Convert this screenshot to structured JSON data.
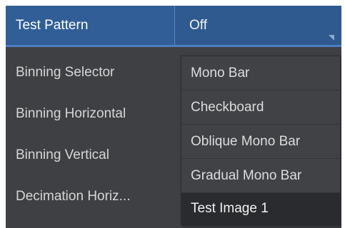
{
  "properties": [
    {
      "label": "Test Pattern",
      "value": "Off"
    },
    {
      "label": "Binning Selector"
    },
    {
      "label": "Binning Horizontal"
    },
    {
      "label": "Binning Vertical"
    },
    {
      "label": "Decimation Horiz..."
    }
  ],
  "dropdown": {
    "options": [
      "Mono Bar",
      "Checkboard",
      "Oblique Mono Bar",
      "Gradual Mono Bar",
      "Test Image 1"
    ],
    "highlighted": "Test Image 1"
  },
  "colors": {
    "panel_bg": "#3f4043",
    "selected_row_bg": "#315e97",
    "dropdown_bg": "#414246"
  },
  "icons": {
    "value_dropdown": "chevron-down-icon"
  }
}
